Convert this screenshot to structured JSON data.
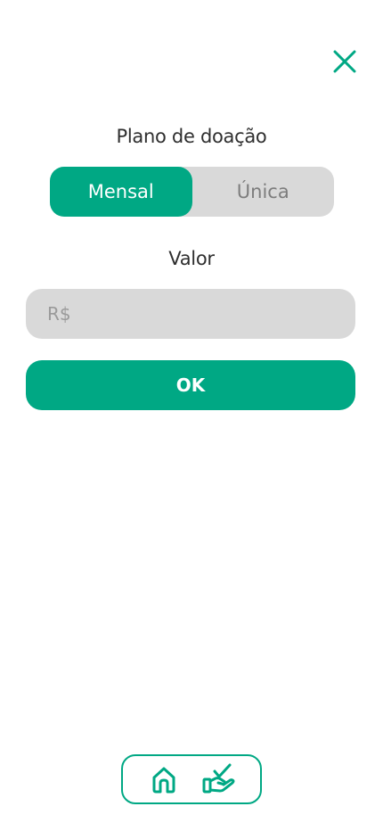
{
  "header": {
    "close_icon": "close-icon"
  },
  "plan": {
    "label": "Plano de doação",
    "options": [
      {
        "label": "Mensal",
        "selected": true
      },
      {
        "label": "Única",
        "selected": false
      }
    ]
  },
  "value": {
    "label": "Valor",
    "placeholder": "R$",
    "current_value": ""
  },
  "submit": {
    "label": "OK"
  },
  "nav": {
    "items": [
      {
        "icon": "home-icon"
      },
      {
        "icon": "donate-hand-icon"
      }
    ]
  },
  "colors": {
    "accent": "#00a884",
    "field_bg": "#d9d9d9",
    "inactive_text": "#7d7d7d",
    "placeholder_text": "#9a9a9a"
  }
}
